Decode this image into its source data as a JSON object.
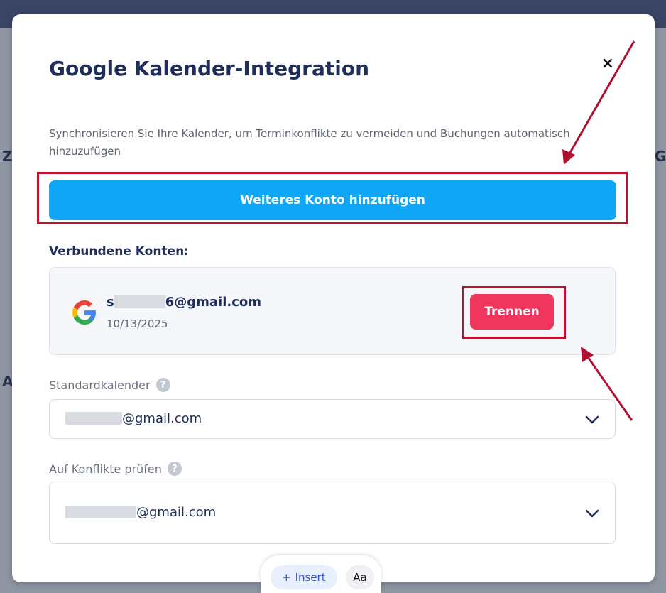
{
  "modal": {
    "title": "Google Kalender-Integration",
    "close_label": "×",
    "description": "Synchronisieren Sie Ihre Kalender, um Terminkonflikte zu vermeiden und Buchungen automatisch hinzuzufügen",
    "add_account_label": "Weiteres Konto hinzufügen",
    "connected_section_label": "Verbundene Konten:",
    "account": {
      "email_prefix": "s",
      "email_suffix": "6@gmail.com",
      "date": "10/13/2025",
      "disconnect_label": "Trennen",
      "icon": "google-icon"
    },
    "default_calendar": {
      "label": "Standardkalender",
      "help": "?",
      "value_suffix": "@gmail.com"
    },
    "conflict_check": {
      "label": "Auf Konflikte prüfen",
      "help": "?",
      "value_suffix": "@gmail.com"
    }
  },
  "toolbar": {
    "insert_label": "Insert",
    "insert_icon": "+",
    "text_format_label": "Aa"
  },
  "colors": {
    "primary_button": "#0fa6f5",
    "danger_button": "#f0365c",
    "annotation": "#c0102e",
    "title": "#1e2d5a"
  }
}
